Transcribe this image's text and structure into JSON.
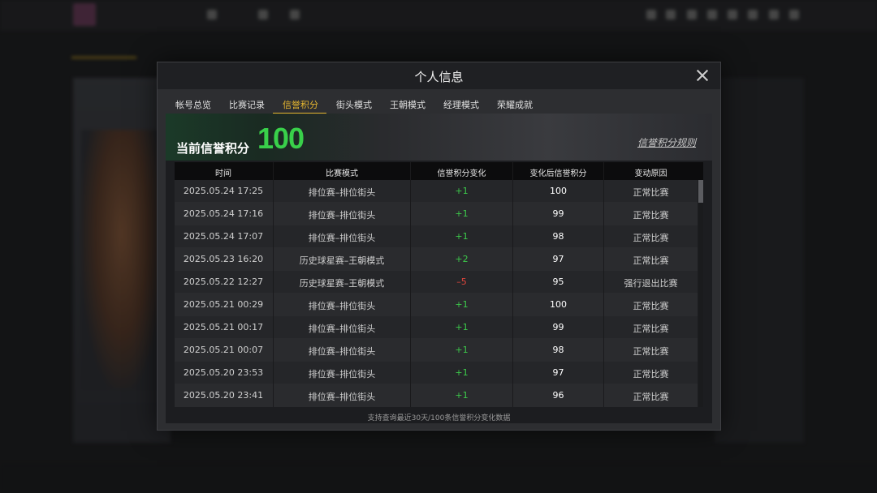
{
  "modal": {
    "title": "个人信息",
    "tabs": [
      "帐号总览",
      "比赛记录",
      "信誉积分",
      "街头模式",
      "王朝模式",
      "经理模式",
      "荣耀成就"
    ],
    "active_tab_index": 2
  },
  "credit": {
    "label": "当前信誉积分",
    "score": "100",
    "rules_link": "信誉积分规则"
  },
  "table": {
    "headers": [
      "时间",
      "比赛模式",
      "信誉积分变化",
      "变化后信誉积分",
      "变动原因"
    ],
    "rows": [
      {
        "time": "2025.05.24  17:25",
        "mode": "排位赛–排位街头",
        "change": "+1",
        "after": "100",
        "reason": "正常比赛"
      },
      {
        "time": "2025.05.24  17:16",
        "mode": "排位赛–排位街头",
        "change": "+1",
        "after": "99",
        "reason": "正常比赛"
      },
      {
        "time": "2025.05.24  17:07",
        "mode": "排位赛–排位街头",
        "change": "+1",
        "after": "98",
        "reason": "正常比赛"
      },
      {
        "time": "2025.05.23  16:20",
        "mode": "历史球星赛–王朝模式",
        "change": "+2",
        "after": "97",
        "reason": "正常比赛"
      },
      {
        "time": "2025.05.22  12:27",
        "mode": "历史球星赛–王朝模式",
        "change": "–5",
        "after": "95",
        "reason": "强行退出比赛"
      },
      {
        "time": "2025.05.21  00:29",
        "mode": "排位赛–排位街头",
        "change": "+1",
        "after": "100",
        "reason": "正常比赛"
      },
      {
        "time": "2025.05.21  00:17",
        "mode": "排位赛–排位街头",
        "change": "+1",
        "after": "99",
        "reason": "正常比赛"
      },
      {
        "time": "2025.05.21  00:07",
        "mode": "排位赛–排位街头",
        "change": "+1",
        "after": "98",
        "reason": "正常比赛"
      },
      {
        "time": "2025.05.20  23:53",
        "mode": "排位赛–排位街头",
        "change": "+1",
        "after": "97",
        "reason": "正常比赛"
      },
      {
        "time": "2025.05.20  23:41",
        "mode": "排位赛–排位街头",
        "change": "+1",
        "after": "96",
        "reason": "正常比赛"
      }
    ]
  },
  "footnote": "支持查询最近30天/100条信誉积分变化数据",
  "colors": {
    "accent": "#e8b830",
    "score_green": "#39d04a",
    "positive": "#3cc84a",
    "negative": "#e0453c"
  }
}
